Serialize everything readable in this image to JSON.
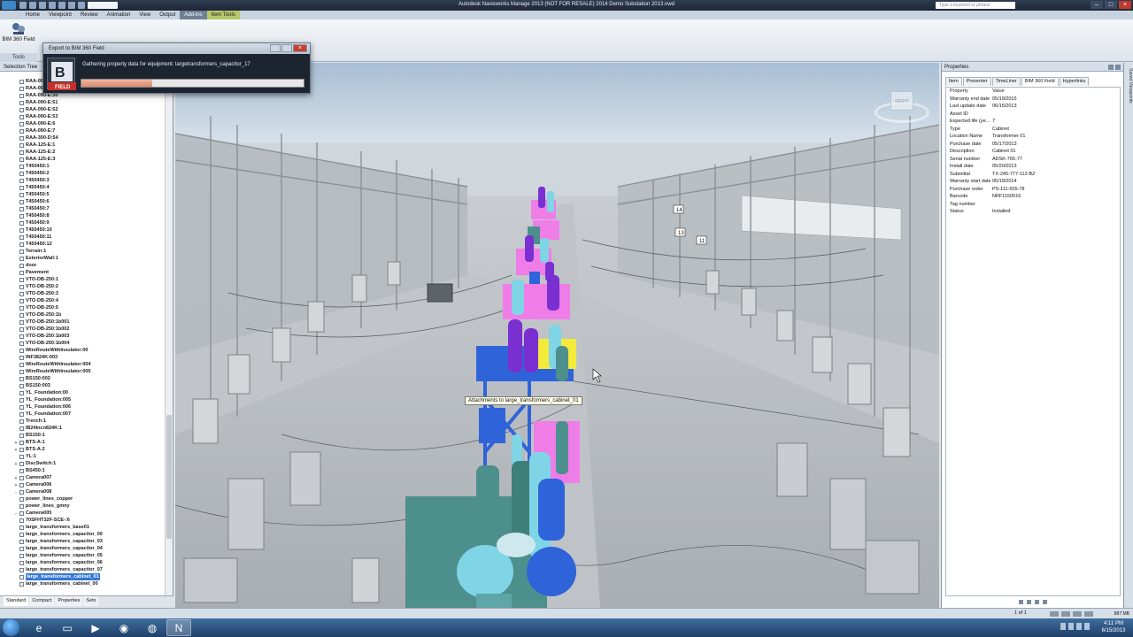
{
  "window": {
    "title": "Autodesk Navisworks Manage 2013 (NOT FOR RESALE)    2014 Demo Substation 2013.nwd",
    "search_placeholder": "Type a keyword or phrase"
  },
  "ribbon": {
    "tabs": [
      "Home",
      "Viewpoint",
      "Review",
      "Animation",
      "View",
      "Output",
      "Add-ins",
      "Item Tools"
    ],
    "active_tab": "Add-ins",
    "context_tab": "Item Tools",
    "bim_button_label": "BIM 360 Field",
    "panel_label": "Tools"
  },
  "selection_tree": {
    "title": "Selection Tree",
    "items": [
      {
        "label": "RAA-090-E:28",
        "expander": ""
      },
      {
        "label": "RAA-090-E:29",
        "expander": ""
      },
      {
        "label": "RAA-090-E:30",
        "expander": ""
      },
      {
        "label": "RAA-090-E:51",
        "expander": ""
      },
      {
        "label": "RAA-090-E:52",
        "expander": ""
      },
      {
        "label": "RAA-090-E:53",
        "expander": ""
      },
      {
        "label": "RAA-090-E:6",
        "expander": ""
      },
      {
        "label": "RAA-090-E:7",
        "expander": ""
      },
      {
        "label": "RAA-300-D:54",
        "expander": ""
      },
      {
        "label": "RAA-125-E:1",
        "expander": ""
      },
      {
        "label": "RAA-125-E:2",
        "expander": ""
      },
      {
        "label": "RAA-125-E:3",
        "expander": ""
      },
      {
        "label": "T450450:1",
        "expander": ""
      },
      {
        "label": "T450450:2",
        "expander": ""
      },
      {
        "label": "T450450:3",
        "expander": ""
      },
      {
        "label": "T450450:4",
        "expander": ""
      },
      {
        "label": "T450450:5",
        "expander": ""
      },
      {
        "label": "T450450:6",
        "expander": ""
      },
      {
        "label": "T450450:7",
        "expander": ""
      },
      {
        "label": "T450450:8",
        "expander": ""
      },
      {
        "label": "T450450:9",
        "expander": ""
      },
      {
        "label": "T450450:10",
        "expander": ""
      },
      {
        "label": "T450450:11",
        "expander": ""
      },
      {
        "label": "T450450:12",
        "expander": ""
      },
      {
        "label": "Terrain:1",
        "expander": ""
      },
      {
        "label": "ExteriorWall:1",
        "expander": ""
      },
      {
        "label": "door",
        "expander": ""
      },
      {
        "label": "Pavement",
        "expander": ""
      },
      {
        "label": "VTO-DB-250:1",
        "expander": ""
      },
      {
        "label": "VTO-DB-250:2",
        "expander": ""
      },
      {
        "label": "VTO-DB-250:3",
        "expander": ""
      },
      {
        "label": "VTO-DB-250:4",
        "expander": ""
      },
      {
        "label": "VTO-DB-250:5",
        "expander": ""
      },
      {
        "label": "VTO-DB-250:1b",
        "expander": ""
      },
      {
        "label": "VTO-DB-250:1b001",
        "expander": ""
      },
      {
        "label": "VTO-DB-250:1b002",
        "expander": ""
      },
      {
        "label": "VTO-DB-250:1b003",
        "expander": ""
      },
      {
        "label": "VTO-DB-250:1b004",
        "expander": ""
      },
      {
        "label": "WireRouteWithInsulator:00",
        "expander": ""
      },
      {
        "label": "INF3824K:003",
        "expander": ""
      },
      {
        "label": "WireRouteWithInsulator:004",
        "expander": ""
      },
      {
        "label": "WireRouteWithInsulator:005",
        "expander": ""
      },
      {
        "label": "BS150:002",
        "expander": ""
      },
      {
        "label": "BS150:003",
        "expander": ""
      },
      {
        "label": "YL_Foundation:00",
        "expander": ""
      },
      {
        "label": "YL_Foundation:005",
        "expander": ""
      },
      {
        "label": "YL_Foundation:006",
        "expander": ""
      },
      {
        "label": "YL_Foundation:007",
        "expander": ""
      },
      {
        "label": "Trench:1",
        "expander": ""
      },
      {
        "label": "IB24Incn824K:1",
        "expander": ""
      },
      {
        "label": "BS150:1",
        "expander": ""
      },
      {
        "label": "BTS-A:1",
        "expander": "+"
      },
      {
        "label": "BTS-A:2",
        "expander": "+"
      },
      {
        "label": "YL:1",
        "expander": ""
      },
      {
        "label": "DiscSwitch:1",
        "expander": "+"
      },
      {
        "label": "BS450:1",
        "expander": ""
      },
      {
        "label": "Camera007",
        "expander": "+"
      },
      {
        "label": "Camera006",
        "expander": "+"
      },
      {
        "label": "Camera008",
        "expander": "-"
      },
      {
        "label": "power_lines_copper",
        "expander": ""
      },
      {
        "label": "power_lines_gmny",
        "expander": ""
      },
      {
        "label": "Camera005",
        "expander": "-"
      },
      {
        "label": "70SFHT32F-SCE-:6",
        "expander": ""
      },
      {
        "label": "large_transformers_base01",
        "expander": ""
      },
      {
        "label": "large_transformers_capacitor_00",
        "expander": ""
      },
      {
        "label": "large_transformers_capacitor_03",
        "expander": ""
      },
      {
        "label": "large_transformers_capacitor_04",
        "expander": ""
      },
      {
        "label": "large_transformers_capacitor_05",
        "expander": ""
      },
      {
        "label": "large_transformers_capacitor_06",
        "expander": ""
      },
      {
        "label": "large_transformers_capacitor_07",
        "expander": ""
      },
      {
        "label": "large_transformers_cabinet_01",
        "expander": "",
        "selected": true
      },
      {
        "label": "large_transformers_cabinet_00",
        "expander": ""
      }
    ],
    "tabs": [
      "Standard",
      "Compact",
      "Properties",
      "Sets"
    ],
    "active_tab": "Standard"
  },
  "export_dialog": {
    "title": "Export to BIM 360 Field",
    "message": "Gathering property data for equipment: largetransformers_capacitor_17",
    "progress": 0.32,
    "logo_text": "FIELD"
  },
  "viewport": {
    "tooltip": "Attachments to large_transformers_cabinet_01",
    "viewcube_label": "RIGHT",
    "markers": [
      "14",
      "13",
      "11"
    ]
  },
  "properties": {
    "title": "Properties",
    "tabs": [
      "Item",
      "Presenter",
      "TimeLiner",
      "BIM 360 Field",
      "Hyperlinks"
    ],
    "active_tab": "BIM 360 Field",
    "col_property": "Property",
    "col_value": "Value",
    "rows": [
      {
        "key": "Warranty end date",
        "value": "05/19/2015"
      },
      {
        "key": "Last update date",
        "value": "06/15/2013"
      },
      {
        "key": "Asset ID",
        "value": ""
      },
      {
        "key": "Expected life (ye...",
        "value": "7"
      },
      {
        "key": "Type",
        "value": "Cabinet"
      },
      {
        "key": "Location Name",
        "value": "Transformer 01"
      },
      {
        "key": "Purchase date",
        "value": "05/17/2013"
      },
      {
        "key": "Description",
        "value": "Cabinet 01"
      },
      {
        "key": "Serial number",
        "value": "ADSK-765-77"
      },
      {
        "key": "Install date",
        "value": "05/20/2013"
      },
      {
        "key": "Submittal",
        "value": "TX-245-777-112-BZ"
      },
      {
        "key": "Warranty start date",
        "value": "05/19/2014"
      },
      {
        "key": "Purchase order",
        "value": "PS-111-555-78"
      },
      {
        "key": "Barcode",
        "value": "NRF1150016"
      },
      {
        "key": "Tag number",
        "value": ""
      },
      {
        "key": "Status",
        "value": "Installed"
      }
    ]
  },
  "saved_viewpoints_label": "Saved Viewpoints",
  "statusbar": {
    "pager": "1 of 1",
    "memory": "887 MB"
  },
  "taskbar": {
    "time": "4:11 PM",
    "date": "6/15/2013"
  },
  "colors": {
    "pink_equipment": "#ef7de8",
    "blue_cabinet": "#2f63d9",
    "purple_bushing": "#7a2fd0",
    "cyan_bushing": "#7fd4e6",
    "teal_transformer": "#4d8f8c",
    "accent_blue": "#3478d4"
  }
}
